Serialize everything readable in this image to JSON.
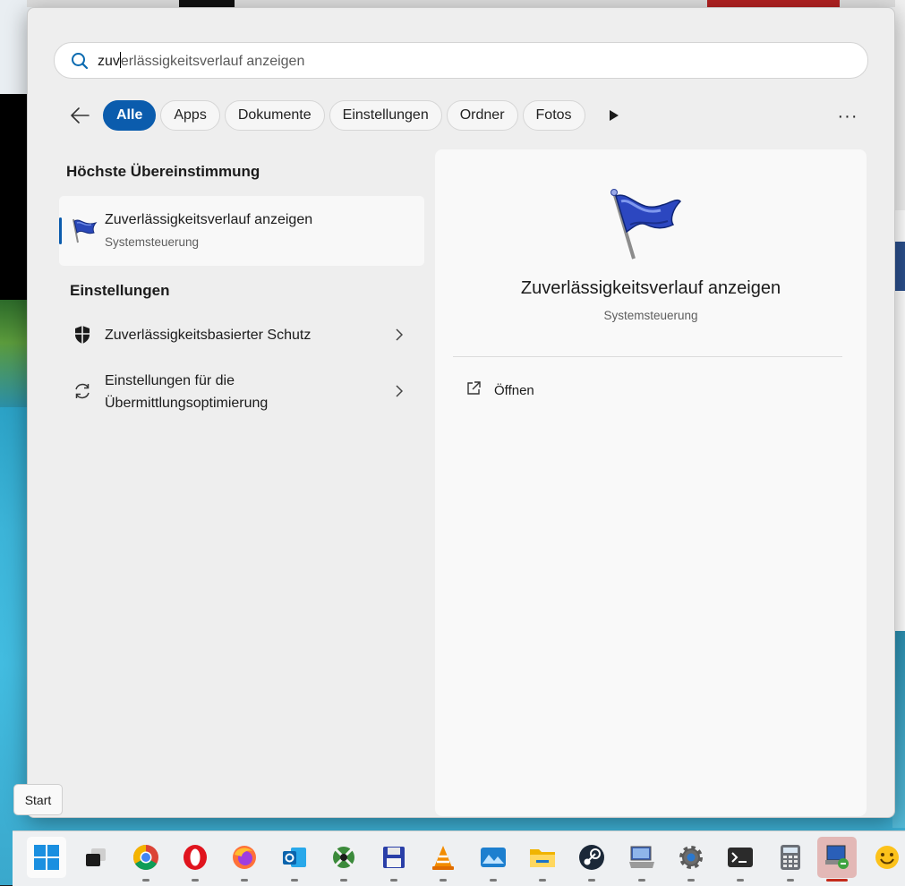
{
  "search": {
    "typed": "zuv",
    "suggestion_rest": "erlässigkeitsverlauf anzeigen"
  },
  "filters": {
    "back_label": "Zurück",
    "chips": [
      "Alle",
      "Apps",
      "Dokumente",
      "Einstellungen",
      "Ordner",
      "Fotos"
    ],
    "active": "Alle"
  },
  "best_match": {
    "heading": "Höchste Übereinstimmung",
    "title": "Zuverlässigkeitsverlauf anzeigen",
    "subtitle": "Systemsteuerung",
    "icon": "blue-flag-icon"
  },
  "settings": {
    "heading": "Einstellungen",
    "items": [
      {
        "label": "Zuverlässigkeitsbasierter Schutz",
        "icon": "shield-icon"
      },
      {
        "label_line1": "Einstellungen für die",
        "label_line2": "Übermittlungsoptimierung",
        "icon": "sync-icon"
      }
    ]
  },
  "detail": {
    "title": "Zuverlässigkeitsverlauf anzeigen",
    "subtitle": "Systemsteuerung",
    "actions": [
      {
        "label": "Öffnen",
        "icon": "open-external-icon"
      }
    ]
  },
  "tooltip": {
    "text": "Start"
  },
  "taskbar": {
    "items": [
      "windows-start-icon",
      "task-view-icon",
      "chrome-icon",
      "opera-icon",
      "firefox-icon",
      "outlook-icon",
      "network-tool-icon",
      "save-disk-icon",
      "vlc-icon",
      "photos-icon",
      "file-explorer-icon",
      "steam-icon",
      "remote-computer-icon",
      "settings-gear-icon",
      "terminal-icon",
      "calculator-icon",
      "remote-desktop-icon",
      "emoji-icon"
    ]
  },
  "colors": {
    "accent": "#0b5cad",
    "panel_bg": "#eeeeee"
  }
}
